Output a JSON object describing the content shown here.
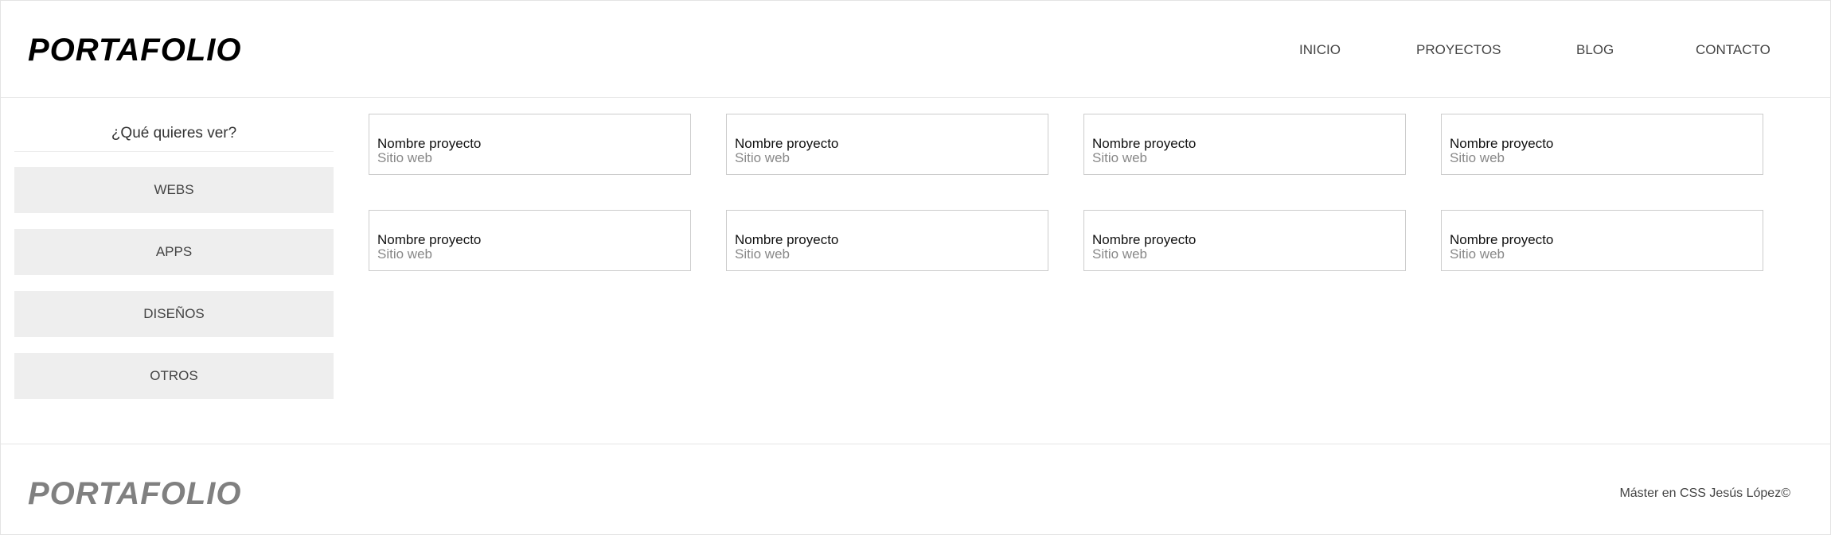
{
  "header": {
    "logo": "PORTAFOLIO",
    "nav": {
      "inicio": "INICIO",
      "proyectos": "PROYECTOS",
      "blog": "BLOG",
      "contacto": "CONTACTO"
    }
  },
  "sidebar": {
    "title": "¿Qué quieres ver?",
    "filters": [
      "WEBS",
      "APPS",
      "DISEÑOS",
      "OTROS"
    ]
  },
  "projects": [
    {
      "title": "Nombre proyecto",
      "subtitle": "Sitio web"
    },
    {
      "title": "Nombre proyecto",
      "subtitle": "Sitio web"
    },
    {
      "title": "Nombre proyecto",
      "subtitle": "Sitio web"
    },
    {
      "title": "Nombre proyecto",
      "subtitle": "Sitio web"
    },
    {
      "title": "Nombre proyecto",
      "subtitle": "Sitio web"
    },
    {
      "title": "Nombre proyecto",
      "subtitle": "Sitio web"
    },
    {
      "title": "Nombre proyecto",
      "subtitle": "Sitio web"
    },
    {
      "title": "Nombre proyecto",
      "subtitle": "Sitio web"
    }
  ],
  "footer": {
    "logo": "PORTAFOLIO",
    "copyright": "Máster en CSS Jesús López©"
  }
}
